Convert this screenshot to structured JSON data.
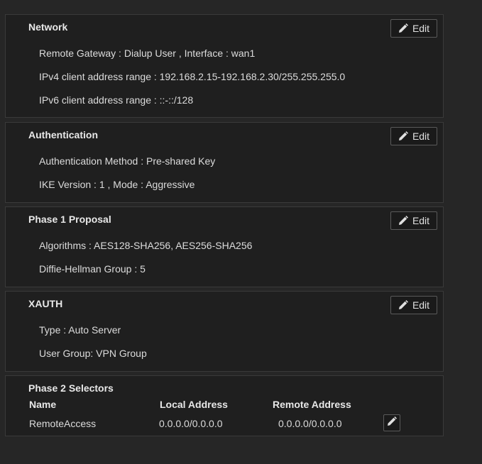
{
  "sections": {
    "network": {
      "title": "Network",
      "edit_label": "Edit",
      "lines": [
        "Remote Gateway : Dialup User , Interface : wan1",
        "IPv4 client address range : 192.168.2.15-192.168.2.30/255.255.255.0",
        "IPv6 client address range : ::-::/128"
      ]
    },
    "authentication": {
      "title": "Authentication",
      "edit_label": "Edit",
      "lines": [
        "Authentication Method : Pre-shared Key",
        "IKE Version : 1 , Mode : Aggressive"
      ]
    },
    "phase1": {
      "title": "Phase 1 Proposal",
      "edit_label": "Edit",
      "lines": [
        "Algorithms : AES128-SHA256, AES256-SHA256",
        "Diffie-Hellman Group : 5"
      ]
    },
    "xauth": {
      "title": "XAUTH",
      "edit_label": "Edit",
      "lines": [
        "Type : Auto Server",
        "User Group: VPN Group"
      ]
    },
    "phase2": {
      "title": "Phase 2 Selectors",
      "columns": [
        "Name",
        "Local Address",
        "Remote Address"
      ],
      "rows": [
        {
          "name": "RemoteAccess",
          "local": "0.0.0.0/0.0.0.0",
          "remote": "0.0.0.0/0.0.0.0"
        }
      ]
    }
  },
  "icons": {
    "edit": "pencil-icon"
  }
}
